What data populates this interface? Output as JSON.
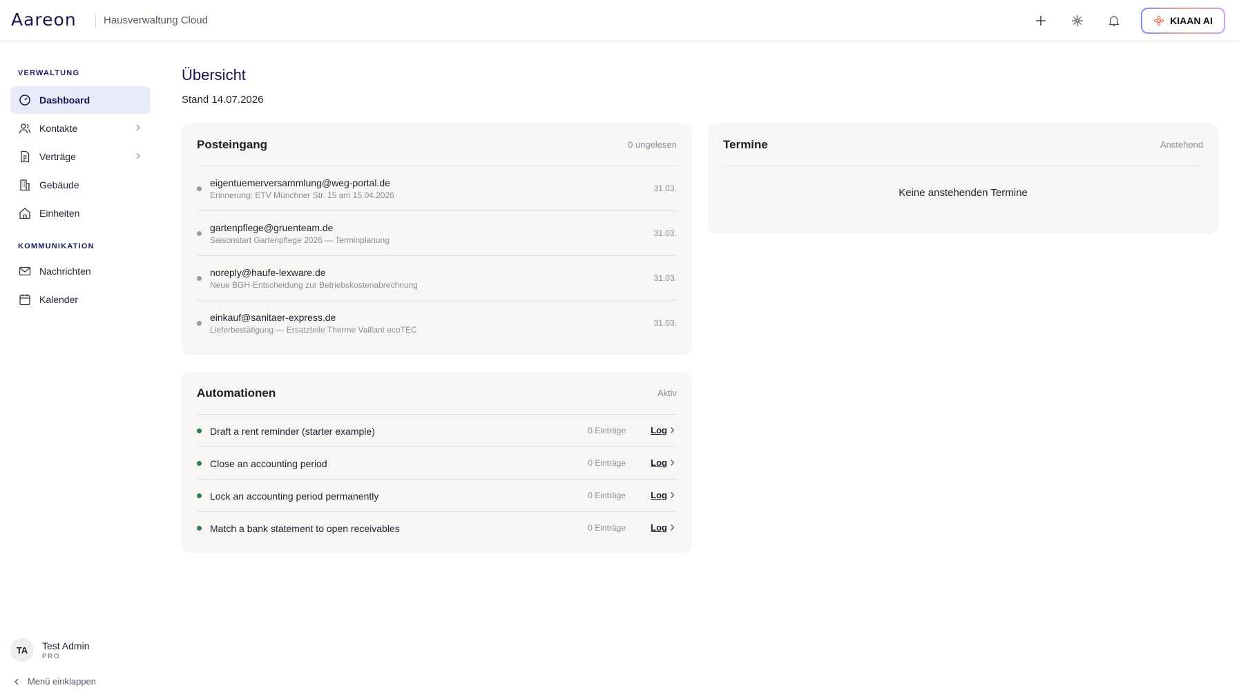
{
  "header": {
    "logo": "Aareon",
    "app_name": "Hausverwaltung Cloud",
    "ai_button": "KIAAN AI"
  },
  "sidebar": {
    "section_admin": "VERWALTUNG",
    "section_comm": "KOMMUNIKATION",
    "items": [
      {
        "label": "Dashboard",
        "icon": "gauge-icon",
        "active": true
      },
      {
        "label": "Kontakte",
        "icon": "users-icon",
        "has_children": true
      },
      {
        "label": "Verträge",
        "icon": "document-icon",
        "has_children": true
      },
      {
        "label": "Gebäude",
        "icon": "building-icon"
      },
      {
        "label": "Einheiten",
        "icon": "home-icon"
      },
      {
        "label": "Nachrichten",
        "icon": "mail-icon"
      },
      {
        "label": "Kalender",
        "icon": "calendar-icon"
      }
    ],
    "user": {
      "initials": "TA",
      "name": "Test Admin",
      "plan": "PRO"
    },
    "collapse_label": "Menü einklappen"
  },
  "main": {
    "title": "Übersicht",
    "subtitle": "Stand 14.07.2026"
  },
  "inbox": {
    "title": "Posteingang",
    "meta": "0 ungelesen",
    "messages": [
      {
        "from": "eigentuemerversammlung@weg-portal.de",
        "subject": "Erinnerung: ETV Münchner Str. 15 am 15.04.2026",
        "date": "31.03."
      },
      {
        "from": "gartenpflege@gruenteam.de",
        "subject": "Saisonstart Gartenpflege 2026 — Terminplanung",
        "date": "31.03."
      },
      {
        "from": "noreply@haufe-lexware.de",
        "subject": "Neue BGH-Entscheidung zur Betriebskostenabrechnung",
        "date": "31.03."
      },
      {
        "from": "einkauf@sanitaer-express.de",
        "subject": "Lieferbestätigung — Ersatzteile Therme Vaillant ecoTEC",
        "date": "31.03."
      }
    ]
  },
  "appointments": {
    "title": "Termine",
    "meta": "Anstehend",
    "empty_text": "Keine anstehenden Termine"
  },
  "automations": {
    "title": "Automationen",
    "meta": "Aktiv",
    "log_label": "Log",
    "items": [
      {
        "name": "Draft a rent reminder (starter example)",
        "count": "0 Einträge"
      },
      {
        "name": "Close an accounting period",
        "count": "0 Einträge"
      },
      {
        "name": "Lock an accounting period permanently",
        "count": "0 Einträge"
      },
      {
        "name": "Match a bank statement to open receivables",
        "count": "0 Einträge"
      }
    ]
  },
  "colors": {
    "brand": "#16164d",
    "active_bg": "#e8ecf8",
    "status_green": "#2f7d4f",
    "unread_dot": "#9a9a9a"
  }
}
